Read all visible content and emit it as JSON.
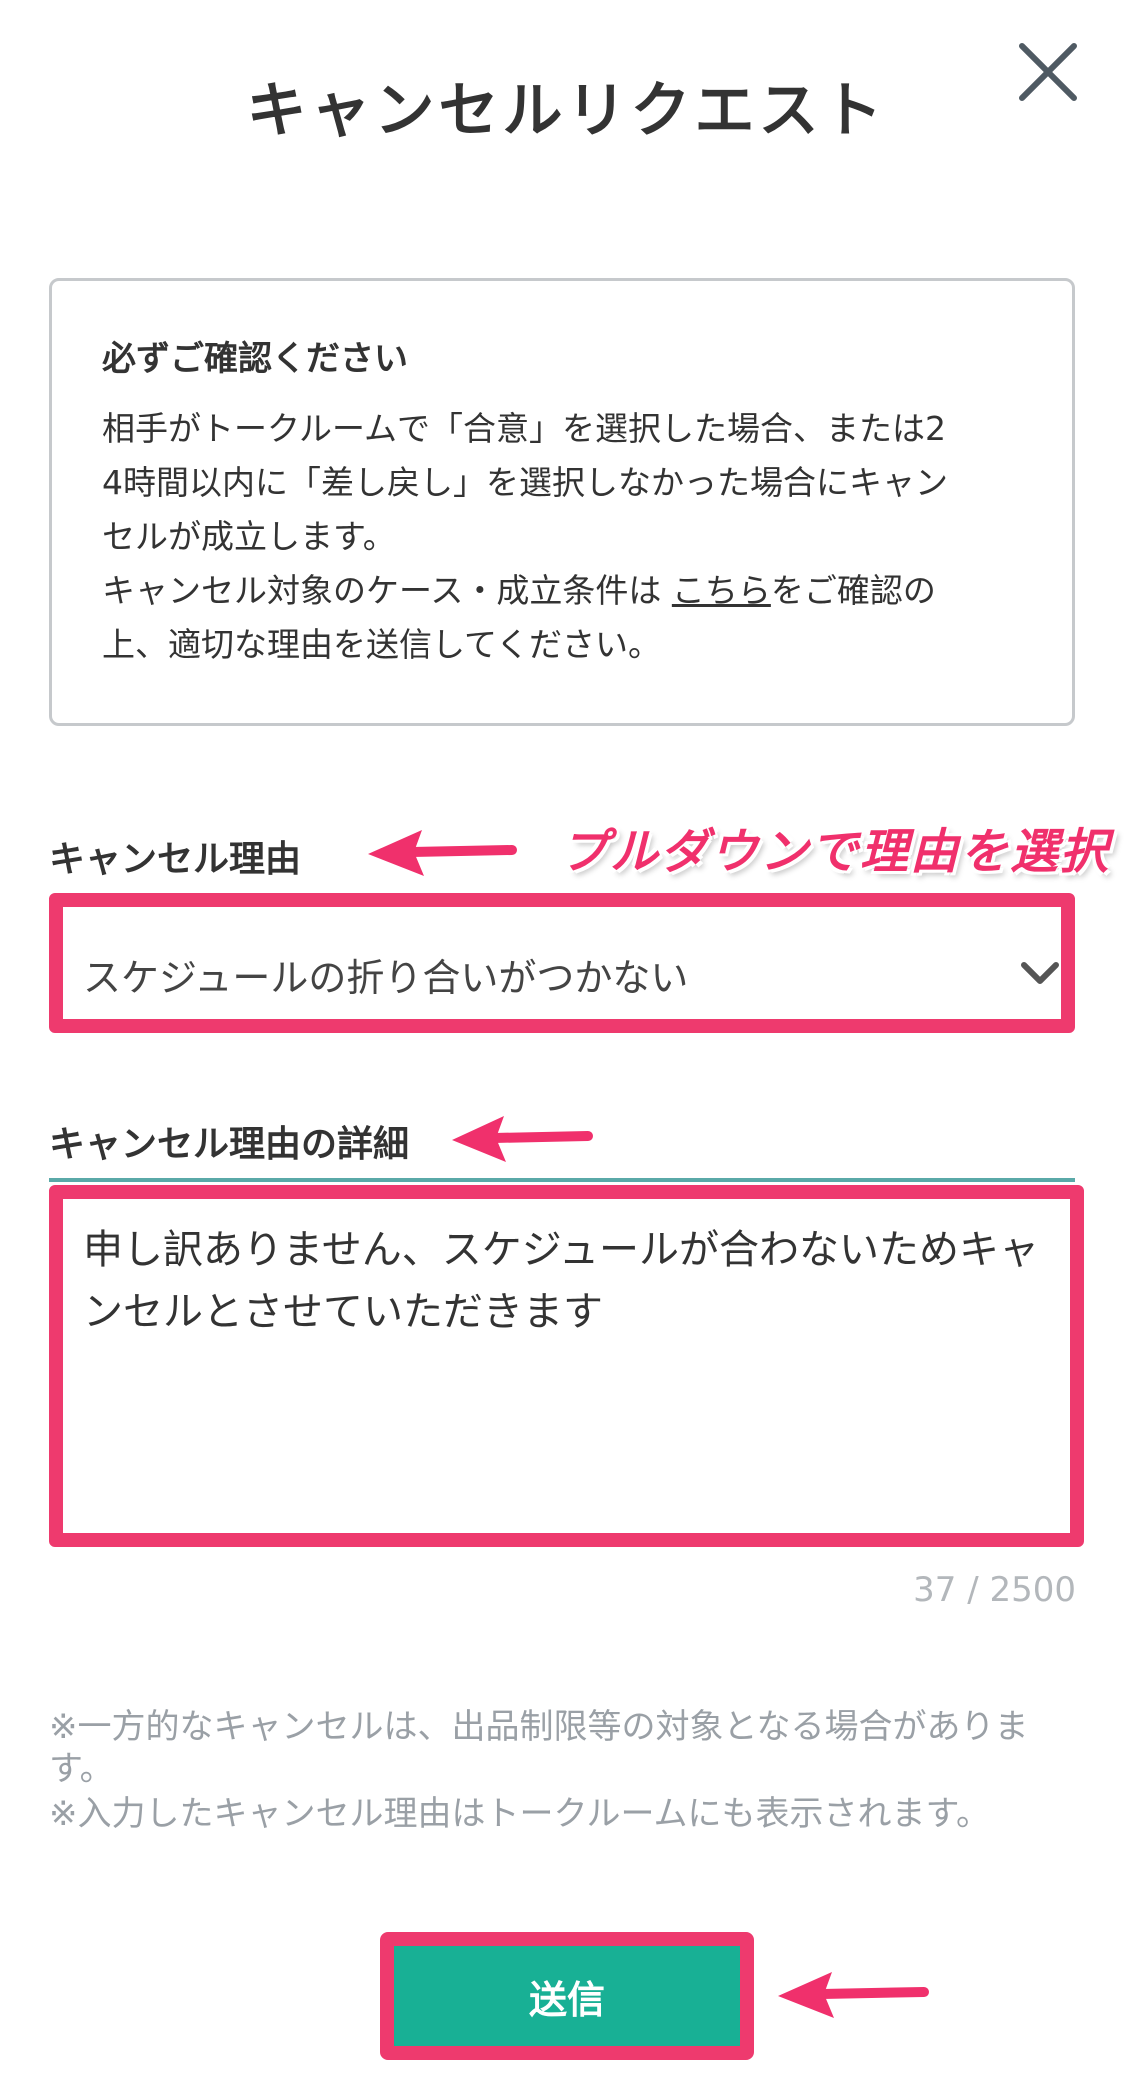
{
  "header": {
    "title": "キャンセルリクエスト"
  },
  "notice": {
    "heading": "必ずご確認ください",
    "line1": "相手がトークルームで「合意」を選択した場合、または2",
    "line2": "4時間以内に「差し戻し」を選択しなかった場合にキャン",
    "line3": "セルが成立します。",
    "line4_before": "キャンセル対象のケース・成立条件は ",
    "link_text": "こちら",
    "line4_after": "をご確認の",
    "line5": "上、適切な理由を送信してください。"
  },
  "reason": {
    "label": "キャンセル理由",
    "selected": "スケジュールの折り合いがつかない"
  },
  "annotation": {
    "text": "プルダウンで理由を選択",
    "color": "#f0306c"
  },
  "detail": {
    "label": "キャンセル理由の詳細",
    "value": "申し訳ありません、スケジュールが合わないためキャンセルとさせていただきます",
    "counter": "37 / 2500"
  },
  "notes": {
    "note1": "※一方的なキャンセルは、出品制限等の対象となる場合があります。",
    "note2": "※入力したキャンセル理由はトークルームにも表示されます。"
  },
  "submit": {
    "label": "送信",
    "color": "#18b095"
  },
  "colors": {
    "highlight": "#ee3a6e",
    "text": "#333333",
    "muted": "#9aa0a6"
  }
}
